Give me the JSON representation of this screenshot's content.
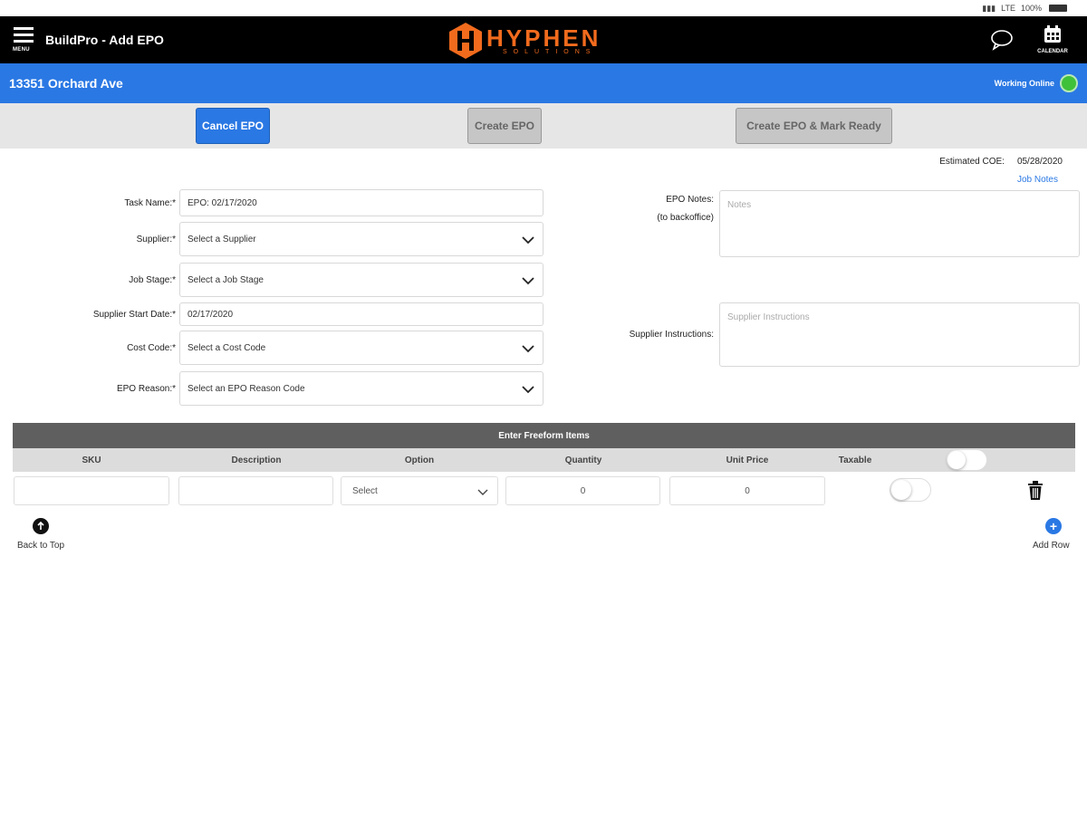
{
  "status_bar": {
    "signal": "LTE",
    "battery": "100%"
  },
  "header": {
    "menu_label": "MENU",
    "app_title": "BuildPro - Add EPO",
    "logo_text": "HYPHEN",
    "logo_subtext": "SOLUTIONS",
    "calendar_label": "CALENDAR",
    "chat_icon": "chat-bubble-icon",
    "calendar_icon": "calendar-icon"
  },
  "address_bar": {
    "address": "13351 Orchard Ave",
    "connection_status": "Working Online",
    "status_color": "#3fc13a"
  },
  "actions": {
    "cancel_label": "Cancel EPO",
    "create_label": "Create EPO",
    "create_ready_label": "Create EPO & Mark Ready"
  },
  "meta": {
    "estimated_coe_label": "Estimated COE:",
    "estimated_coe_value": "05/28/2020",
    "job_notes_link": "Job Notes"
  },
  "form": {
    "task_name": {
      "label": "Task Name:*",
      "value": "EPO: 02/17/2020"
    },
    "supplier": {
      "label": "Supplier:*",
      "value": "Select a Supplier"
    },
    "job_stage": {
      "label": "Job Stage:*",
      "value": "Select a Job Stage"
    },
    "supplier_start_date": {
      "label": "Supplier Start Date:*",
      "value": "02/17/2020"
    },
    "cost_code": {
      "label": "Cost Code:*",
      "value": "Select a Cost Code"
    },
    "epo_reason": {
      "label": "EPO Reason:*",
      "value": "Select an EPO Reason Code"
    },
    "epo_notes": {
      "label": "EPO Notes:",
      "sublabel": "(to backoffice)",
      "placeholder": "Notes"
    },
    "supplier_instructions": {
      "label": "Supplier Instructions:",
      "placeholder": "Supplier Instructions"
    }
  },
  "freeform": {
    "title": "Enter Freeform Items",
    "columns": [
      "SKU",
      "Description",
      "Option",
      "Quantity",
      "Unit Price",
      "Taxable"
    ],
    "row": {
      "sku": "",
      "description": "",
      "option": "Select",
      "quantity": "0",
      "unit_price": "0",
      "taxable": false
    }
  },
  "footer": {
    "back_to_top": "Back to Top",
    "add_row": "Add Row"
  },
  "colors": {
    "brand_blue": "#2a78e4",
    "logo_orange": "#f26b1d",
    "header_black": "#000000"
  }
}
